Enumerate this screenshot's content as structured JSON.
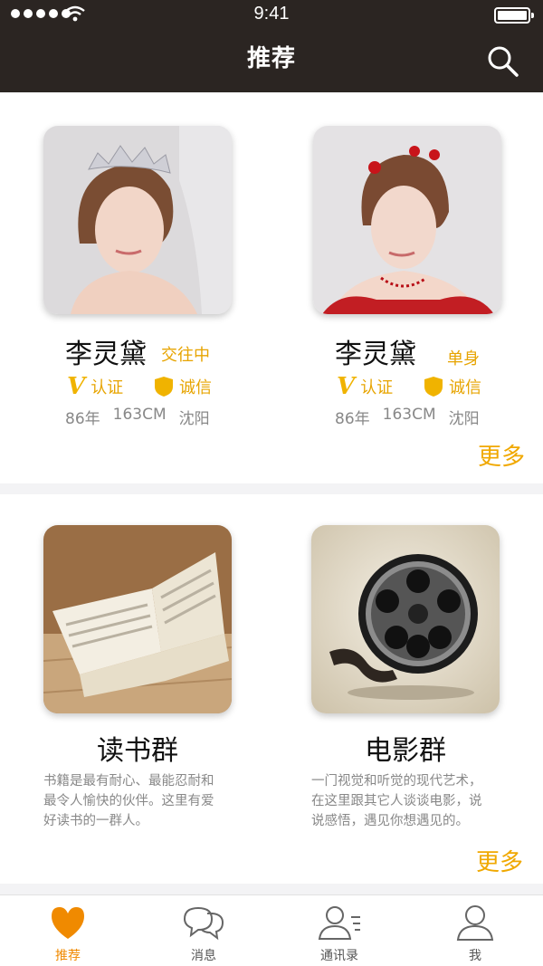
{
  "status_bar": {
    "time": "9:41"
  },
  "header": {
    "title": "推荐"
  },
  "people": [
    {
      "name": "李灵黛",
      "relationship": "交往中",
      "verified": "认证",
      "credit": "诚信",
      "year": "86年",
      "height": "163CM",
      "city": "沈阳"
    },
    {
      "name": "李灵黛",
      "relationship": "单身",
      "verified": "认证",
      "credit": "诚信",
      "year": "86年",
      "height": "163CM",
      "city": "沈阳"
    }
  ],
  "people_more": "更多",
  "groups": [
    {
      "name": "读书群",
      "description": [
        "书籍是最有耐心、最能忍耐和",
        "最令人愉快的伙伴。这里有爱",
        "好读书的一群人。"
      ]
    },
    {
      "name": "电影群",
      "description": [
        "一门视觉和听觉的现代艺术，",
        "在这里跟其它人谈谈电影，说",
        "说感悟，遇见你想遇见的。"
      ]
    }
  ],
  "groups_more": "更多",
  "tabs": [
    {
      "label": "推荐",
      "icon": "heart-icon",
      "active": true
    },
    {
      "label": "消息",
      "icon": "chat-icon",
      "active": false
    },
    {
      "label": "通讯录",
      "icon": "contacts-icon",
      "active": false
    },
    {
      "label": "我",
      "icon": "profile-icon",
      "active": false
    }
  ],
  "colors": {
    "header_bg": "#2b2522",
    "accent": "#f0a800",
    "active_tab": "#f08a00"
  }
}
